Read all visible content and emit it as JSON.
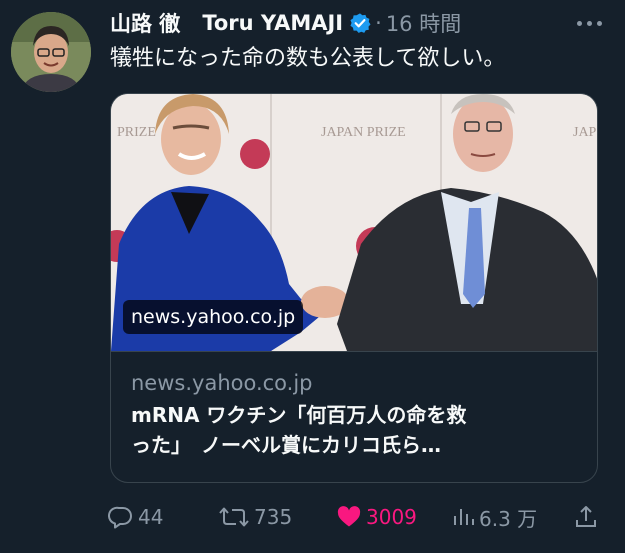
{
  "tweet": {
    "display_name": "山路 徹",
    "screen_name": "Toru YAMAJI",
    "separator": "·",
    "time": "16 時間",
    "text": "犠牲になった命の数も公表して欲しい。"
  },
  "card": {
    "image_overlay_domain": "news.yahoo.co.jp",
    "domain": "news.yahoo.co.jp",
    "title_line1": "mRNA ワクチン「何百万人の命を救",
    "title_line2": "った」　ノーベル賞にカリコ氏ら…",
    "backdrop_text": {
      "left": "PRIZE",
      "center": "JAPAN PRIZE",
      "right": "JAP"
    }
  },
  "actions": {
    "replies": "44",
    "retweets": "735",
    "likes": "3009",
    "views": "6.3 万"
  },
  "colors": {
    "background": "#15202b",
    "text": "#f7f9f9",
    "secondary": "#8b98a5",
    "verified": "#1d9bf0",
    "like": "#f91880",
    "border": "#38444d"
  },
  "icons": [
    "avatar",
    "verified-badge-icon",
    "more-icon",
    "reply-icon",
    "retweet-icon",
    "heart-icon",
    "views-icon",
    "share-icon"
  ]
}
